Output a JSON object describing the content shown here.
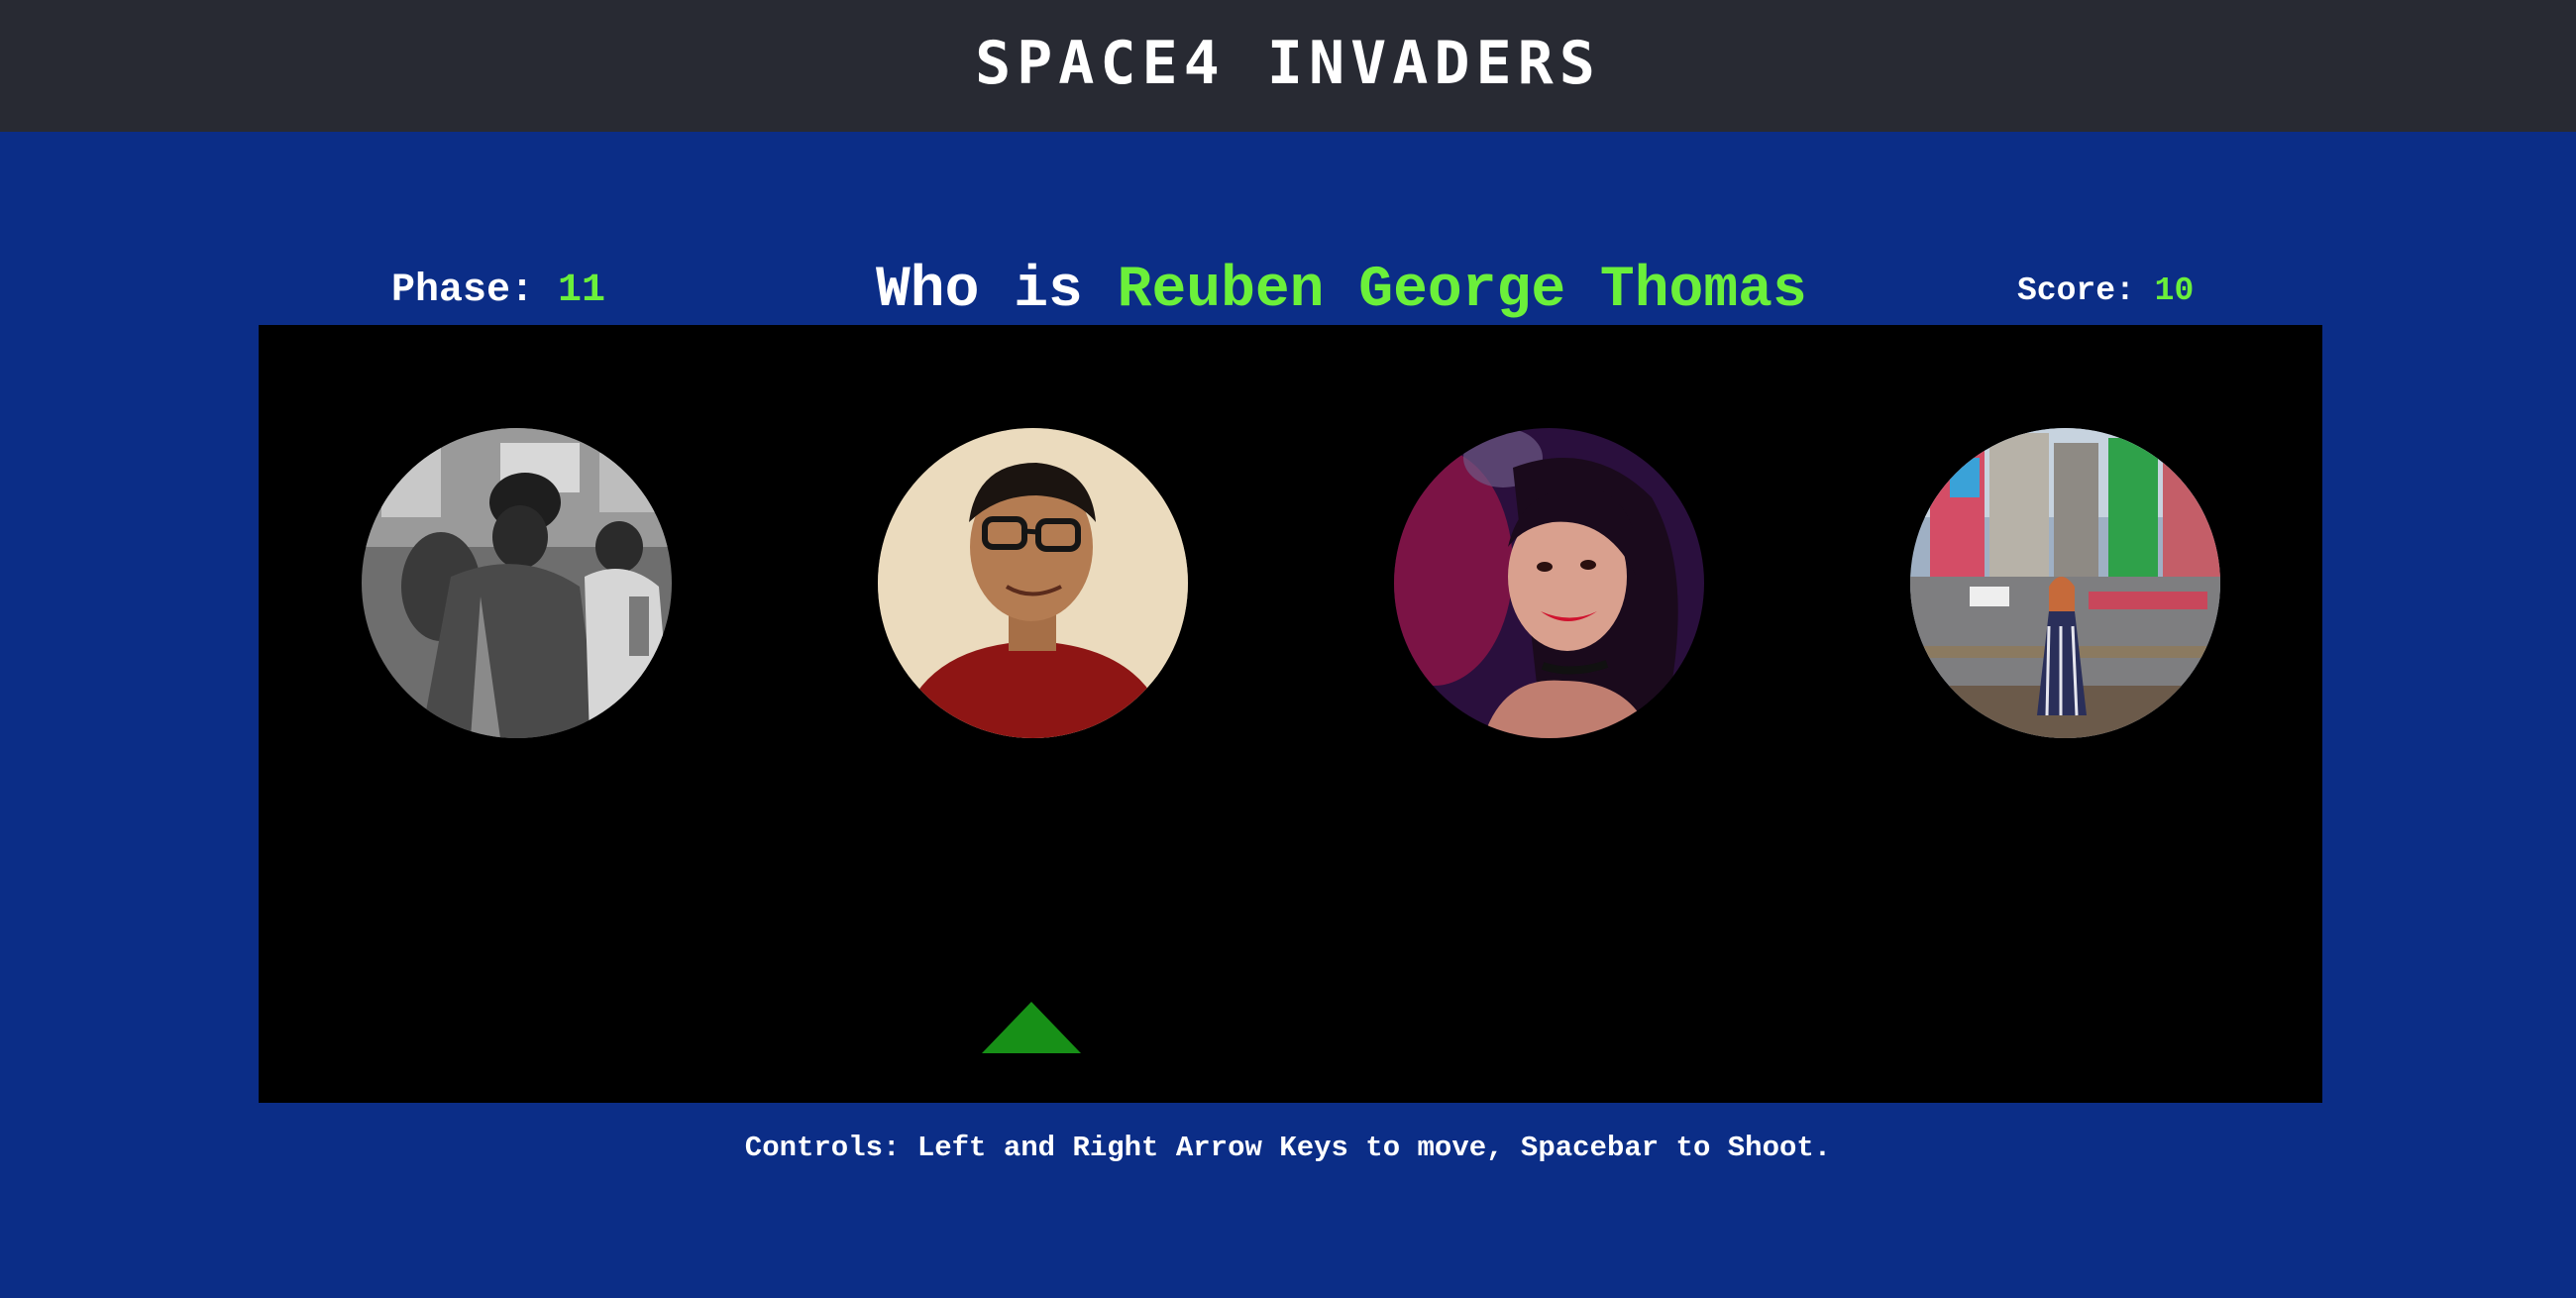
{
  "header": {
    "title": "SPACE4 INVADERS"
  },
  "hud": {
    "phase_label": "Phase:",
    "phase_value": "11",
    "question_prefix": "Who is",
    "target_name": "Reuben George Thomas",
    "score_label": "Score:",
    "score_value": "10"
  },
  "board": {
    "invaders": [
      {
        "id": "invader-1",
        "description": "grayscale street photo"
      },
      {
        "id": "invader-2",
        "description": "smiling man with glasses in red shirt"
      },
      {
        "id": "invader-3",
        "description": "smiling woman in magenta light"
      },
      {
        "id": "invader-4",
        "description": "woman standing in city street"
      }
    ],
    "player_ship_color": "#179017"
  },
  "footer": {
    "controls": "Controls: Left and Right Arrow Keys to move, Spacebar to Shoot."
  },
  "colors": {
    "background": "#0b2d87",
    "header_bg": "#282a33",
    "accent_green": "#6bf03a",
    "board_bg": "#000000"
  }
}
